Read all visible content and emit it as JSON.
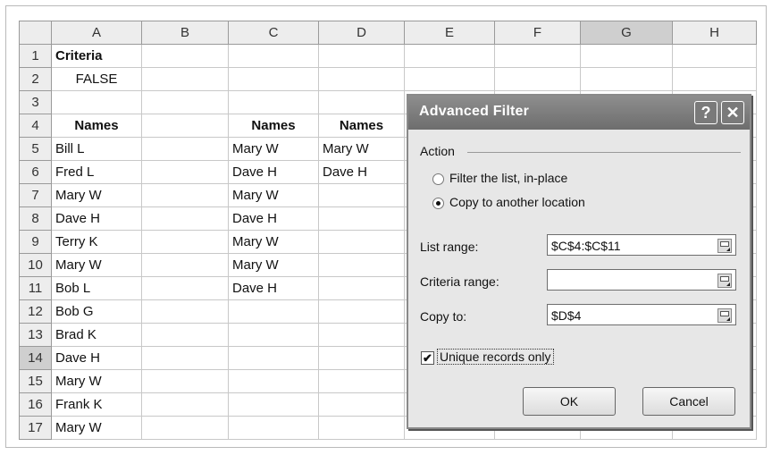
{
  "columns": [
    "A",
    "B",
    "C",
    "D",
    "E",
    "F",
    "G",
    "H"
  ],
  "rows": [
    {
      "n": "1",
      "a": "Criteria",
      "c": "",
      "d": ""
    },
    {
      "n": "2",
      "a": "FALSE",
      "c": "",
      "d": ""
    },
    {
      "n": "3",
      "a": "",
      "c": "",
      "d": ""
    },
    {
      "n": "4",
      "a": "Names",
      "c": "Names",
      "d": "Names"
    },
    {
      "n": "5",
      "a": "Bill L",
      "c": "Mary W",
      "d": "Mary W"
    },
    {
      "n": "6",
      "a": "Fred L",
      "c": "Dave H",
      "d": "Dave H"
    },
    {
      "n": "7",
      "a": "Mary W",
      "c": "Mary W",
      "d": ""
    },
    {
      "n": "8",
      "a": "Dave H",
      "c": "Dave H",
      "d": ""
    },
    {
      "n": "9",
      "a": "Terry K",
      "c": "Mary W",
      "d": ""
    },
    {
      "n": "10",
      "a": "Mary W",
      "c": "Mary W",
      "d": ""
    },
    {
      "n": "11",
      "a": "Bob L",
      "c": "Dave H",
      "d": ""
    },
    {
      "n": "12",
      "a": "Bob G",
      "c": "",
      "d": ""
    },
    {
      "n": "13",
      "a": "Brad K",
      "c": "",
      "d": ""
    },
    {
      "n": "14",
      "a": "Dave H",
      "c": "",
      "d": ""
    },
    {
      "n": "15",
      "a": "Mary W",
      "c": "",
      "d": ""
    },
    {
      "n": "16",
      "a": "Frank K",
      "c": "",
      "d": ""
    },
    {
      "n": "17",
      "a": "Mary W",
      "c": "",
      "d": ""
    }
  ],
  "selected_column": "G",
  "selected_row": "14",
  "dialog": {
    "title": "Advanced Filter",
    "help_glyph": "?",
    "close_glyph": "✕",
    "action_label": "Action",
    "radio_filter_in_place": "Filter the list, in-place",
    "radio_copy_to_location": "Copy to another location",
    "selected_action": "copy",
    "list_range_label": "List range:",
    "list_range_value": "$C$4:$C$11",
    "criteria_range_label": "Criteria range:",
    "criteria_range_value": "",
    "copy_to_label": "Copy to:",
    "copy_to_value": "$D$4",
    "unique_label": "Unique records only",
    "unique_checked": true,
    "check_glyph": "✔",
    "ok_label": "OK",
    "cancel_label": "Cancel"
  }
}
